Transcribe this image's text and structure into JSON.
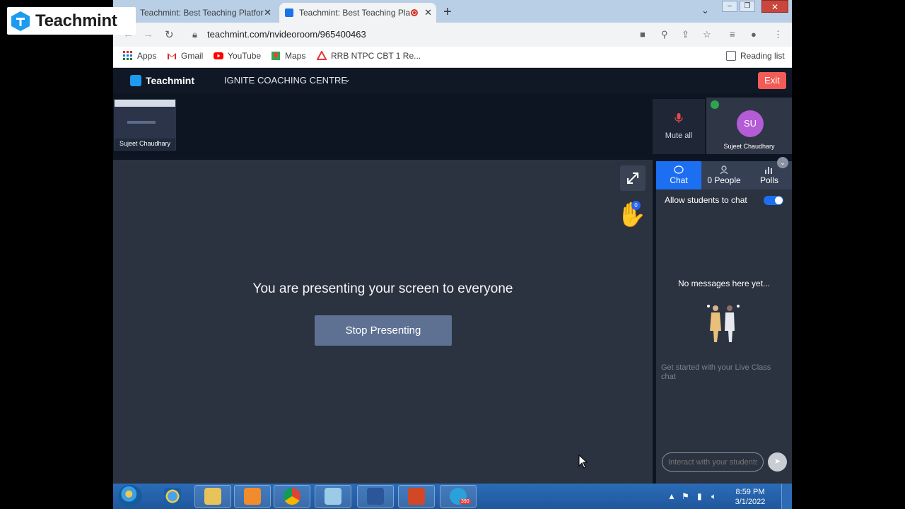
{
  "watermark": {
    "text": "Teachmint"
  },
  "browser": {
    "tabs": [
      {
        "title": "Teachmint: Best Teaching Platfor",
        "active": false
      },
      {
        "title": "Teachmint: Best Teaching Pla",
        "active": true
      }
    ],
    "new_tab": "+",
    "url": "teachmint.com/nvideoroom/965400463",
    "bookmarks": [
      "Apps",
      "Gmail",
      "YouTube",
      "Maps",
      "RRB NTPC CBT 1 Re..."
    ],
    "reading_list": "Reading list"
  },
  "app": {
    "brand": "Teachmint",
    "class_name": "IGNITE COACHING CENTRE",
    "exit_label": "Exit",
    "thumbnail_name": "Sujeet Chaudhary",
    "presenting_message": "You are presenting your screen to everyone",
    "stop_presenting_label": "Stop Presenting",
    "raised_hands_count": "0",
    "mute_all_label": "Mute all",
    "participant": {
      "initials": "SU",
      "name": "Sujeet Chaudhary",
      "avatar_color": "#b45bd6"
    },
    "side_tabs": [
      {
        "label": "Chat",
        "active": true
      },
      {
        "label": "0 People",
        "active": false
      },
      {
        "label": "Polls",
        "active": false
      }
    ],
    "allow_chat_label": "Allow students to chat",
    "allow_chat_enabled": true,
    "no_messages": "No messages here yet...",
    "help_text": "Get started with your Live Class chat",
    "chat_placeholder": "Interact with your students"
  },
  "taskbar": {
    "time": "8:59 PM",
    "date": "3/1/2022",
    "telegram_badge": "390"
  },
  "colors": {
    "accent": "#1d6ff2",
    "exit": "#f25b56",
    "stop_button": "#5e7193"
  }
}
